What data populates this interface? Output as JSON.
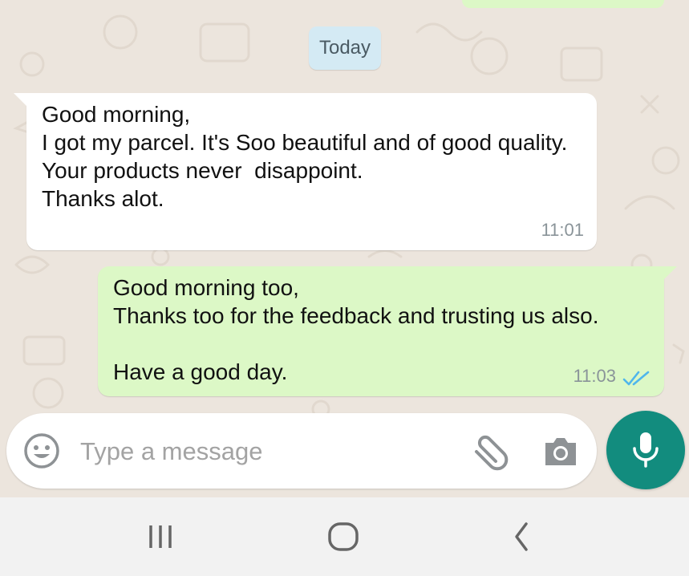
{
  "date_chip": "Today",
  "messages": [
    {
      "direction": "incoming",
      "text": "Good morning,\nI got my parcel. It's Soo beautiful and of good quality.\nYour products never  disappoint.\nThanks alot.",
      "time": "11:01"
    },
    {
      "direction": "outgoing",
      "text": "Good morning too,\nThanks too for the feedback and trusting us also.\n\nHave a good day.",
      "time": "11:03",
      "status_icon": "double-check-read-icon"
    }
  ],
  "composer": {
    "placeholder": "Type a message",
    "value": "",
    "emoji_icon": "emoji-icon",
    "attach_icon": "paperclip-icon",
    "camera_icon": "camera-icon",
    "mic_icon": "microphone-icon"
  },
  "navbar": {
    "icons": [
      "recents-icon",
      "home-icon",
      "back-icon"
    ]
  },
  "colors": {
    "chat_background": "#ece5dd",
    "incoming_bubble": "#ffffff",
    "outgoing_bubble": "#dcf8c6",
    "date_chip": "#d4eaf4",
    "accent": "#128c7e",
    "read_ticks": "#4fb6ec"
  }
}
